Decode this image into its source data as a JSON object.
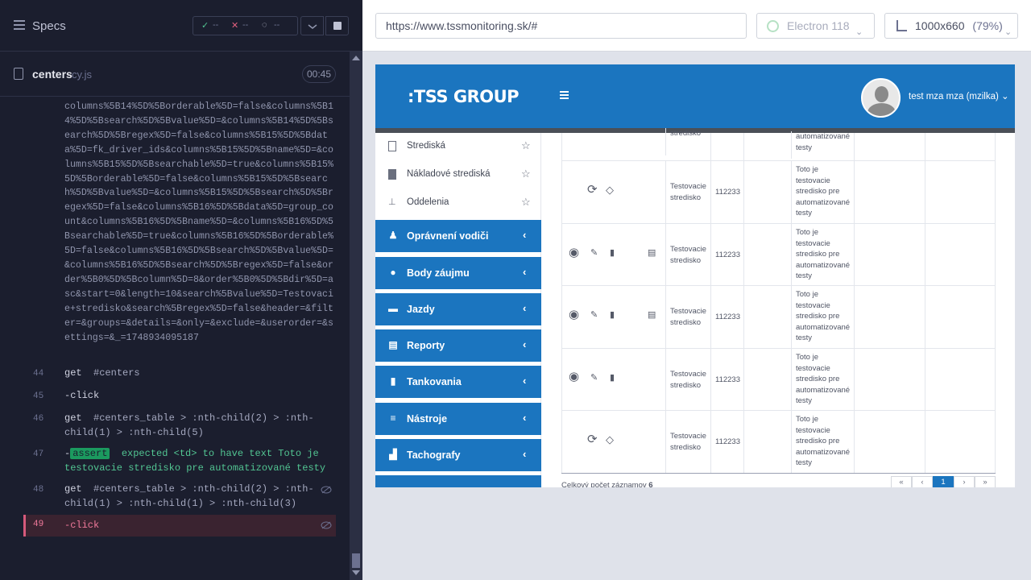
{
  "runner": {
    "specs_label": "Specs",
    "stats": {
      "passed": "--",
      "failed": "--",
      "pending": "--"
    },
    "file": {
      "name": "centers",
      "ext": "cy.js",
      "timer": "00:45"
    },
    "url_log": "columns%5B14%5D%5Borderable%5D=false&columns%5B14%5D%5Bsearch%5D%5Bvalue%5D=&columns%5B14%5D%5Bsearch%5D%5Bregex%5D=false&columns%5B15%5D%5Bdata%5D=fk_driver_ids&columns%5B15%5D%5Bname%5D=&columns%5B15%5D%5Bsearchable%5D=true&columns%5B15%5D%5Borderable%5D=false&columns%5B15%5D%5Bsearch%5D%5Bvalue%5D=&columns%5B15%5D%5Bsearch%5D%5Bregex%5D=false&columns%5B16%5D%5Bdata%5D=group_count&columns%5B16%5D%5Bname%5D=&columns%5B16%5D%5Bsearchable%5D=true&columns%5B16%5D%5Borderable%5D=false&columns%5B16%5D%5Bsearch%5D%5Bvalue%5D=&columns%5B16%5D%5Bsearch%5D%5Bregex%5D=false&order%5B0%5D%5Bcolumn%5D=8&order%5B0%5D%5Bdir%5D=asc&start=0&length=10&search%5Bvalue%5D=Testovacie+stredisko&search%5Bregex%5D=false&header=&filter=&groups=&details=&only=&exclude=&userorder=&settings=&_=1748934095187",
    "commands": [
      {
        "line": "44",
        "cmd": "get",
        "arg": "#centers"
      },
      {
        "line": "45",
        "cmd": "-click",
        "arg": ""
      },
      {
        "line": "46",
        "cmd": "get",
        "arg": "#centers_table > :nth-child(2) > :nth-child(1) > :nth-child(5)"
      },
      {
        "line": "47",
        "cmd": "-",
        "tag": "assert",
        "arg": "expected <td> to have text Toto je testovacie stredisko pre automatizované testy"
      },
      {
        "line": "48",
        "cmd": "get",
        "arg": "#centers_table > :nth-child(2) > :nth-child(1) > :nth-child(1) > :nth-child(3)"
      },
      {
        "line": "49",
        "cmd": "-click",
        "arg": ""
      }
    ]
  },
  "aut": {
    "url": "https://www.tssmonitoring.sk/#",
    "browser": "Electron 118",
    "viewport": "1000x660",
    "zoom": "(79%)"
  },
  "app": {
    "logo": ":TSS GROUP",
    "user": "test mza mza (mzilka) ⌄",
    "submenu": [
      {
        "label": "Strediská"
      },
      {
        "label": "Nákladové strediská"
      },
      {
        "label": "Oddelenia"
      }
    ],
    "nav": [
      {
        "label": "Oprávnení vodiči",
        "icon": "person-icon"
      },
      {
        "label": "Body záujmu",
        "icon": "pin-icon"
      },
      {
        "label": "Jazdy",
        "icon": "car-icon"
      },
      {
        "label": "Reporty",
        "icon": "document-icon"
      },
      {
        "label": "Tankovania",
        "icon": "fuel-icon"
      },
      {
        "label": "Nástroje",
        "icon": "sliders-icon"
      },
      {
        "label": "Tachografy",
        "icon": "chart-icon"
      }
    ],
    "table": {
      "partial_top": {
        "name": "stredisko",
        "desc": "automatizované testy"
      },
      "rows": [
        {
          "name": "Testovacie stredisko",
          "code": "112233",
          "desc": "Toto je testovacie stredisko pre automatizované testy",
          "kind": "restore"
        },
        {
          "name": "Testovacie stredisko",
          "code": "112233",
          "desc": "Toto je testovacie stredisko pre automatizované testy",
          "kind": "edit"
        },
        {
          "name": "Testovacie stredisko",
          "code": "112233",
          "desc": "Toto je testovacie stredisko pre automatizované testy",
          "kind": "edit"
        },
        {
          "name": "Testovacie stredisko",
          "code": "112233",
          "desc": "Toto je testovacie stredisko pre automatizované testy",
          "kind": "edit"
        },
        {
          "name": "Testovacie stredisko",
          "code": "112233",
          "desc": "Toto je testovacie stredisko pre automatizované testy",
          "kind": "restore"
        }
      ],
      "total_label": "Celkový počet záznamov",
      "total_value": "6",
      "pager": [
        "«",
        "‹",
        "1",
        "›",
        "»"
      ]
    }
  }
}
